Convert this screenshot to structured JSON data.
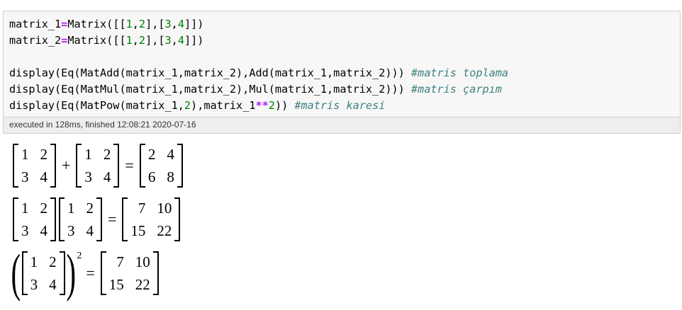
{
  "code_cell": {
    "lines": [
      [
        {
          "t": "matrix_1"
        },
        {
          "t": "=",
          "c": "op"
        },
        {
          "t": "Matrix([["
        },
        {
          "t": "1",
          "c": "num"
        },
        {
          "t": ","
        },
        {
          "t": "2",
          "c": "num"
        },
        {
          "t": "],["
        },
        {
          "t": "3",
          "c": "num"
        },
        {
          "t": ","
        },
        {
          "t": "4",
          "c": "num"
        },
        {
          "t": "]])"
        }
      ],
      [
        {
          "t": "matrix_2"
        },
        {
          "t": "=",
          "c": "op"
        },
        {
          "t": "Matrix([["
        },
        {
          "t": "1",
          "c": "num"
        },
        {
          "t": ","
        },
        {
          "t": "2",
          "c": "num"
        },
        {
          "t": "],["
        },
        {
          "t": "3",
          "c": "num"
        },
        {
          "t": ","
        },
        {
          "t": "4",
          "c": "num"
        },
        {
          "t": "]])"
        }
      ],
      [],
      [
        {
          "t": "display(Eq(MatAdd(matrix_1,matrix_2),Add(matrix_1,matrix_2))) "
        },
        {
          "t": "#matris toplama",
          "c": "cm"
        }
      ],
      [
        {
          "t": "display(Eq(MatMul(matrix_1,matrix_2),Mul(matrix_1,matrix_2))) "
        },
        {
          "t": "#matris çarpım",
          "c": "cm"
        }
      ],
      [
        {
          "t": "display(Eq(MatPow(matrix_1,"
        },
        {
          "t": "2",
          "c": "num"
        },
        {
          "t": "),matrix_1"
        },
        {
          "t": "**",
          "c": "op"
        },
        {
          "t": "2",
          "c": "num"
        },
        {
          "t": ")) "
        },
        {
          "t": "#matris karesi",
          "c": "cm"
        }
      ]
    ],
    "exec_info": "executed in 128ms, finished 12:08:21 2020-07-16"
  },
  "output": {
    "eq1": {
      "a": [
        "1",
        "2",
        "3",
        "4"
      ],
      "op": "+",
      "b": [
        "1",
        "2",
        "3",
        "4"
      ],
      "eq": "=",
      "r": [
        "2",
        "4",
        "6",
        "8"
      ]
    },
    "eq2": {
      "a": [
        "1",
        "2",
        "3",
        "4"
      ],
      "b": [
        "1",
        "2",
        "3",
        "4"
      ],
      "eq": "=",
      "r": [
        "7",
        "10",
        "15",
        "22"
      ]
    },
    "eq3": {
      "a": [
        "1",
        "2",
        "3",
        "4"
      ],
      "exp": "2",
      "eq": "=",
      "r": [
        "7",
        "10",
        "15",
        "22"
      ]
    }
  }
}
